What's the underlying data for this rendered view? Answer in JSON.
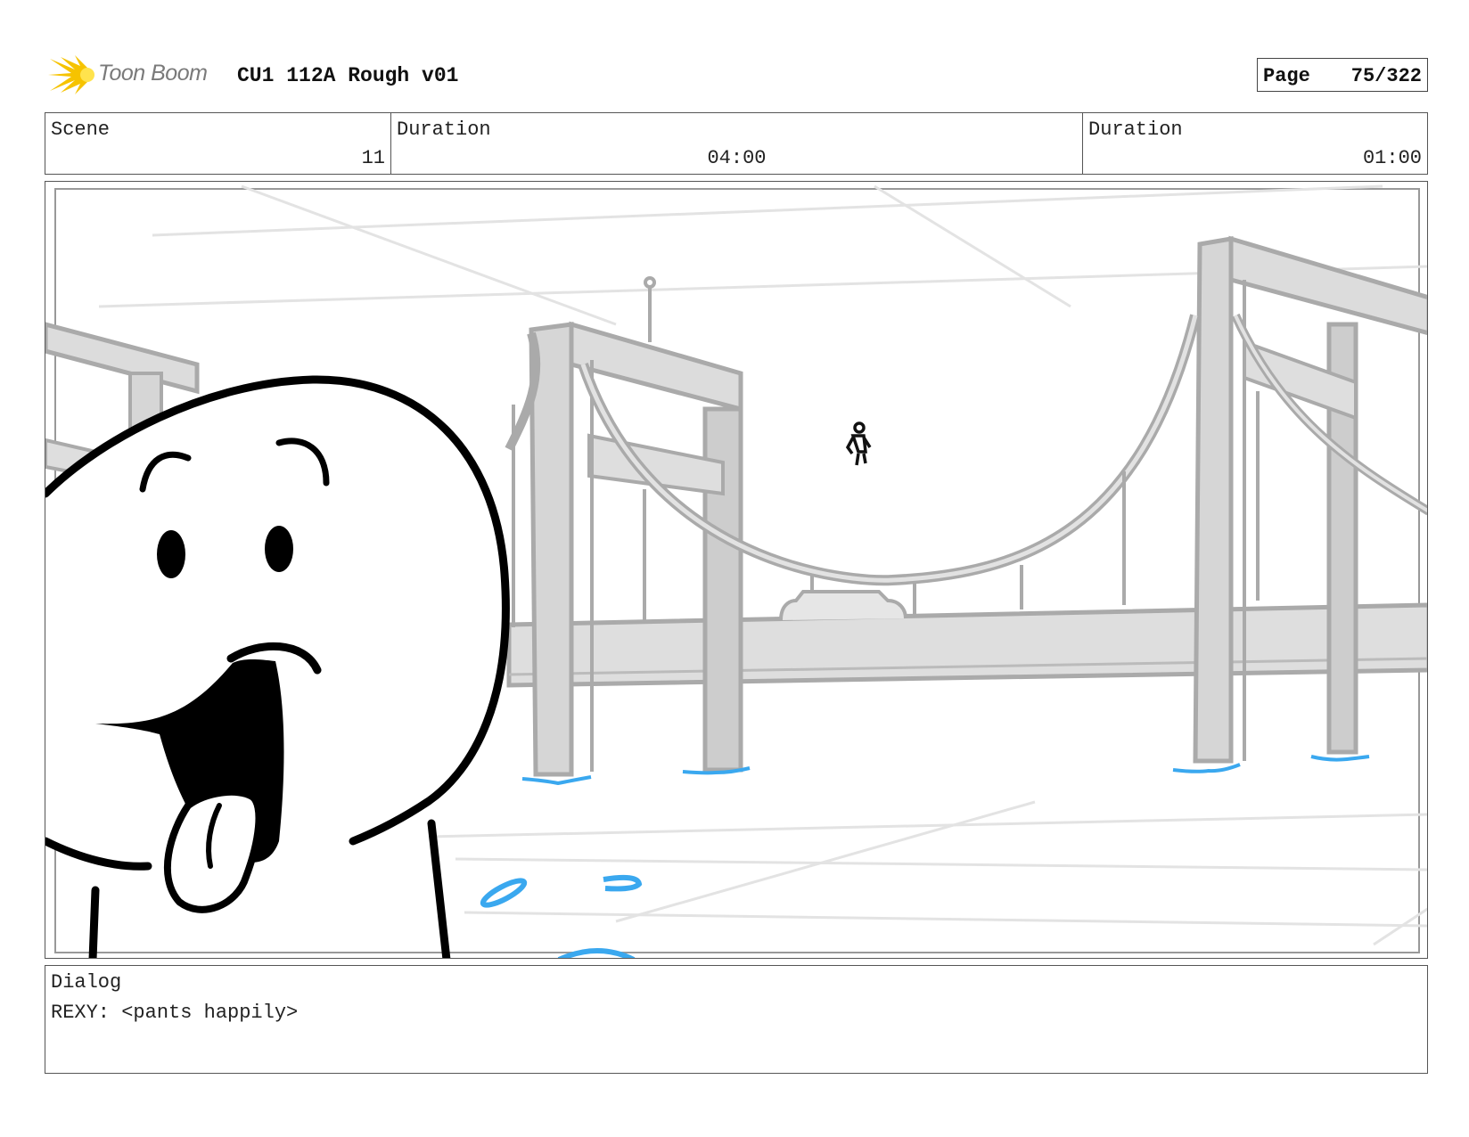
{
  "header": {
    "logo_text": "Toon Boom",
    "title": "CU1 112A Rough v01",
    "page_label": "Page",
    "page_value": "75/322"
  },
  "info": {
    "scene_label": "Scene",
    "scene_value": "11",
    "duration1_label": "Duration",
    "duration1_value": "04:00",
    "duration2_label": "Duration",
    "duration2_value": "01:00"
  },
  "dialog": {
    "label": "Dialog",
    "text": "REXY: <pants happily>"
  },
  "colors": {
    "ink": "#000000",
    "bridge_fill": "#dcdcdc",
    "bridge_line": "#a9a9a9",
    "water": "#3aa8ef",
    "logo_yellow": "#f6c300"
  }
}
